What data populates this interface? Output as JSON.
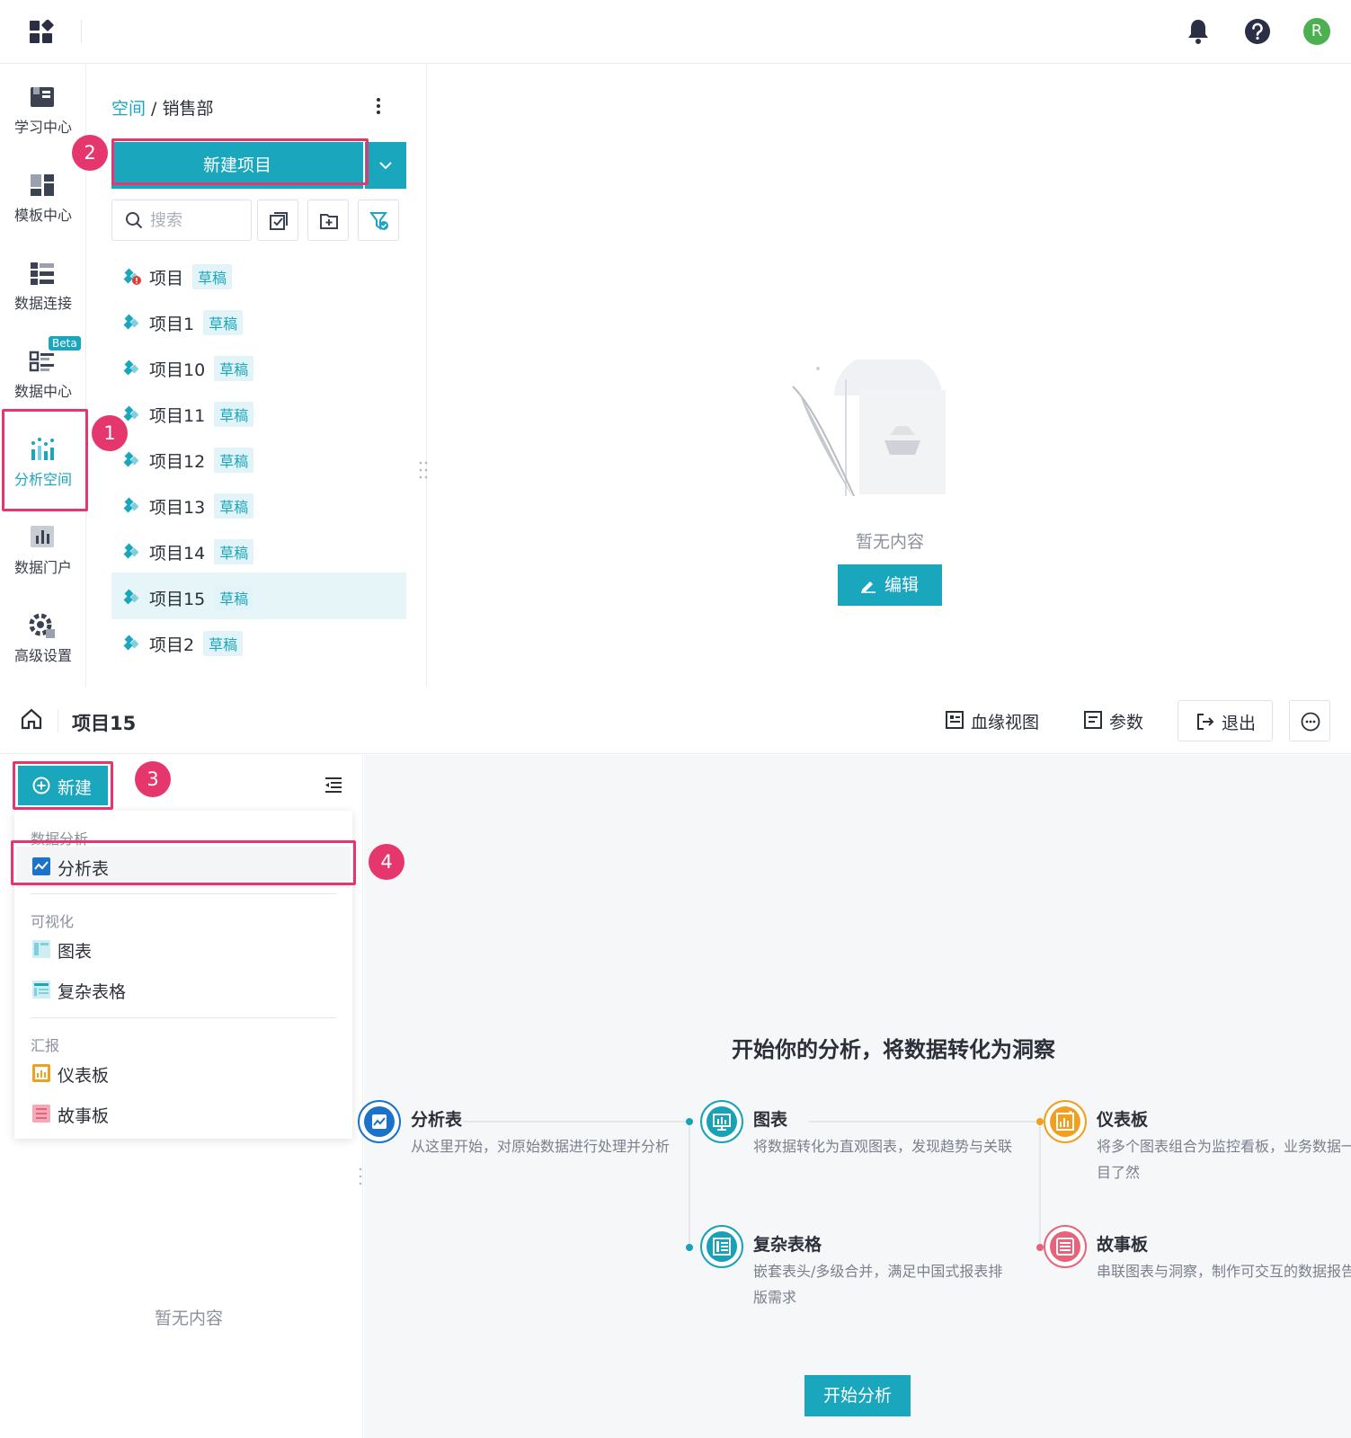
{
  "topbar": {
    "apps_icon": "apps-grid-icon",
    "bell_icon": "bell-icon",
    "help_icon": "help-icon",
    "avatar_letter": "R"
  },
  "rail": {
    "items": [
      {
        "label": "学习中心",
        "icon": "book-icon"
      },
      {
        "label": "模板中心",
        "icon": "template-icon"
      },
      {
        "label": "数据连接",
        "icon": "data-connect-icon"
      },
      {
        "label": "数据中心",
        "icon": "data-center-icon",
        "badge": "Beta"
      },
      {
        "label": "分析空间",
        "icon": "analysis-space-icon"
      },
      {
        "label": "数据门户",
        "icon": "portal-icon"
      },
      {
        "label": "高级设置",
        "icon": "gear-icon"
      }
    ]
  },
  "panel": {
    "breadcrumb_root": "空间",
    "breadcrumb_sep": " / ",
    "breadcrumb_current": "销售部",
    "new_project_label": "新建项目",
    "search_placeholder": "搜索",
    "draft_label": "草稿",
    "projects": [
      "项目",
      "项目1",
      "项目10",
      "项目11",
      "项目12",
      "项目13",
      "项目14",
      "项目15",
      "项目2"
    ]
  },
  "top_empty": {
    "text": "暂无内容",
    "edit_label": "编辑"
  },
  "header": {
    "title": "项目15",
    "lineage_label": "血缘视图",
    "params_label": "参数",
    "exit_label": "退出"
  },
  "left": {
    "new_label": "新建",
    "groups": {
      "analysis": "数据分析",
      "visual": "可视化",
      "report": "汇报"
    },
    "items": {
      "analysis_table": "分析表",
      "chart": "图表",
      "complex_table": "复杂表格",
      "dashboard": "仪表板",
      "storyboard": "故事板"
    },
    "empty_text": "暂无内容"
  },
  "main": {
    "title": "开始你的分析，将数据转化为洞察",
    "features": [
      {
        "title": "分析表",
        "desc": "从这里开始，对原始数据进行处理并分析",
        "color": "#1a73c8"
      },
      {
        "title": "图表",
        "desc": "将数据转化为直观图表，发现趋势与关联",
        "color": "#17a2b8"
      },
      {
        "title": "仪表板",
        "desc": "将多个图表组合为监控看板，业务数据一目了然",
        "color": "#f0a020"
      },
      {
        "title": "复杂表格",
        "desc": "嵌套表头/多级合并，满足中国式报表排版需求",
        "color": "#17a2b8"
      },
      {
        "title": "故事板",
        "desc": "串联图表与洞察，制作可交互的数据报告",
        "color": "#e8637a"
      }
    ],
    "start_label": "开始分析"
  },
  "annotations": [
    "1",
    "2",
    "3",
    "4"
  ],
  "colors": {
    "accent": "#1aa6bd",
    "highlight": "#e5376e"
  }
}
